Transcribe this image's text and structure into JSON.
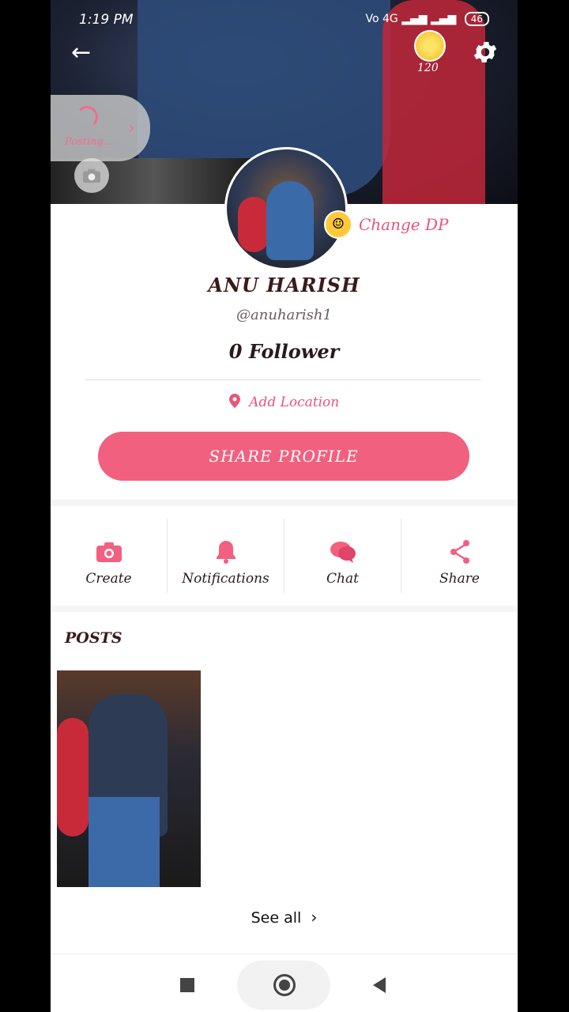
{
  "status_bar": {
    "time": "1:19 PM",
    "network": "Vo 4G",
    "battery": "46"
  },
  "header": {
    "coin_count": "120",
    "posting_label": "Posting..."
  },
  "profile": {
    "change_dp": "Change DP",
    "name": "ANU HARISH",
    "handle": "@anuharish1",
    "followers": "0 Follower",
    "add_location": "Add Location",
    "share_button": "SHARE PROFILE"
  },
  "actions": [
    {
      "label": "Create",
      "icon": "camera-icon"
    },
    {
      "label": "Notifications",
      "icon": "bell-icon"
    },
    {
      "label": "Chat",
      "icon": "chat-icon"
    },
    {
      "label": "Share",
      "icon": "share-icon"
    }
  ],
  "posts": {
    "title": "POSTS",
    "see_all": "See all"
  },
  "colors": {
    "accent": "#f2607f",
    "accent_text": "#e8547a",
    "name_text": "#3b1a1a"
  }
}
